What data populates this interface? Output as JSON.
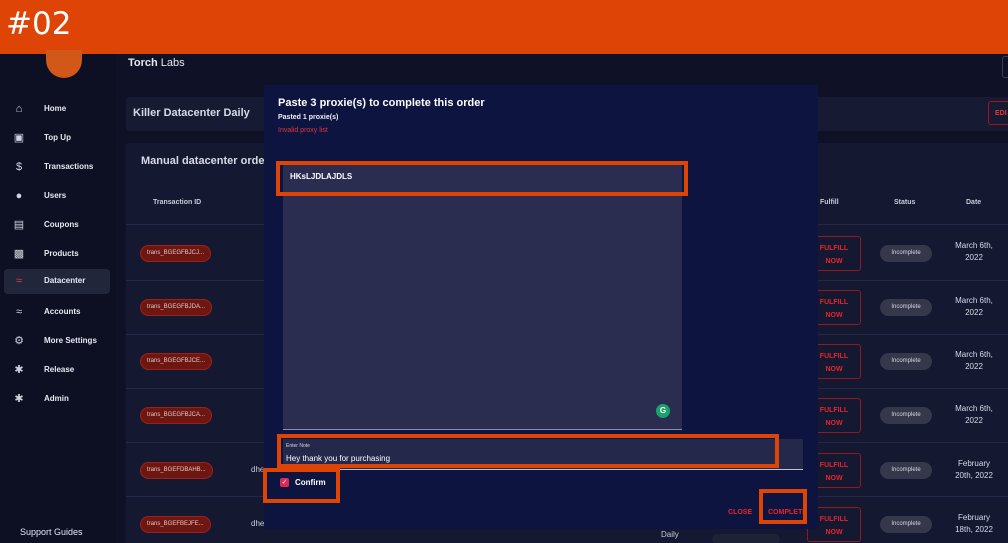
{
  "banner": {
    "label": "#02"
  },
  "colors": {
    "banner": "#dd4405",
    "accent_red": "#e5252e",
    "modal_bg": "#0d1440",
    "highlight": "#dd4405"
  },
  "sidebar": {
    "items": [
      {
        "label": "Home",
        "icon": "home-icon"
      },
      {
        "label": "Top Up",
        "icon": "wallet-icon"
      },
      {
        "label": "Transactions",
        "icon": "dollar-icon"
      },
      {
        "label": "Users",
        "icon": "user-icon"
      },
      {
        "label": "Coupons",
        "icon": "coupon-icon"
      },
      {
        "label": "Products",
        "icon": "briefcase-icon"
      },
      {
        "label": "Datacenter",
        "icon": "wifi-icon",
        "active": true
      },
      {
        "label": "Accounts",
        "icon": "wifi-icon"
      },
      {
        "label": "More Settings",
        "icon": "gear-icon"
      },
      {
        "label": "Release",
        "icon": "badge-icon"
      },
      {
        "label": "Admin",
        "icon": "badge-icon"
      }
    ],
    "support": "Support Guides"
  },
  "header": {
    "brand_bold": "Torch",
    "brand_rest": " Labs"
  },
  "product_card": {
    "title": "Killer Datacenter Daily",
    "edit_label": "EDI"
  },
  "orders": {
    "title": "Manual datacenter orde",
    "columns": {
      "transaction_id": "Transaction ID",
      "fulfill": "Fulfill",
      "status": "Status",
      "date": "Date"
    },
    "rows": [
      {
        "id": "trans_BGEGFBJCJ...",
        "customer": "",
        "fulfill": "FULFILL NOW",
        "status": "Incomplete",
        "date_line1": "March 6th,",
        "date_line2": "2022"
      },
      {
        "id": "trans_BGEGFBJDA...",
        "customer": "",
        "fulfill": "FULFILL NOW",
        "status": "Incomplete",
        "date_line1": "March 6th,",
        "date_line2": "2022"
      },
      {
        "id": "trans_BGEGFBJCE...",
        "customer": "",
        "fulfill": "FULFILL NOW",
        "status": "Incomplete",
        "date_line1": "March 6th,",
        "date_line2": "2022"
      },
      {
        "id": "trans_BGEGFBJCA...",
        "customer": "",
        "fulfill": "FULFILL NOW",
        "status": "Incomplete",
        "date_line1": "March 6th,",
        "date_line2": "2022"
      },
      {
        "id": "trans_BGEFDBAHB...",
        "customer": "dhe",
        "fulfill": "FULFILL NOW",
        "status": "Incomplete",
        "date_line1": "February",
        "date_line2": "20th, 2022"
      },
      {
        "id": "trans_BGEFBEJFE...",
        "customer": "dhe",
        "fulfill": "FULFILL NOW",
        "status": "Incomplete",
        "date_line1": "February",
        "date_line2": "18th, 2022"
      }
    ],
    "partial_text": "Daily"
  },
  "modal": {
    "title": "Paste 3 proxie(s) to complete this order",
    "pasted": "Pasted 1 proxie(s)",
    "error": "Invalid proxy list",
    "proxies_value": "HKsLJDLAJDLS",
    "note_label": "Enter Note",
    "note_value": "Hey thank you for purchasing",
    "confirm_label": "Confirm",
    "confirm_checked": true,
    "close_label": "CLOSE",
    "complete_label": "COMPLETE",
    "grammar_icon": "G"
  }
}
